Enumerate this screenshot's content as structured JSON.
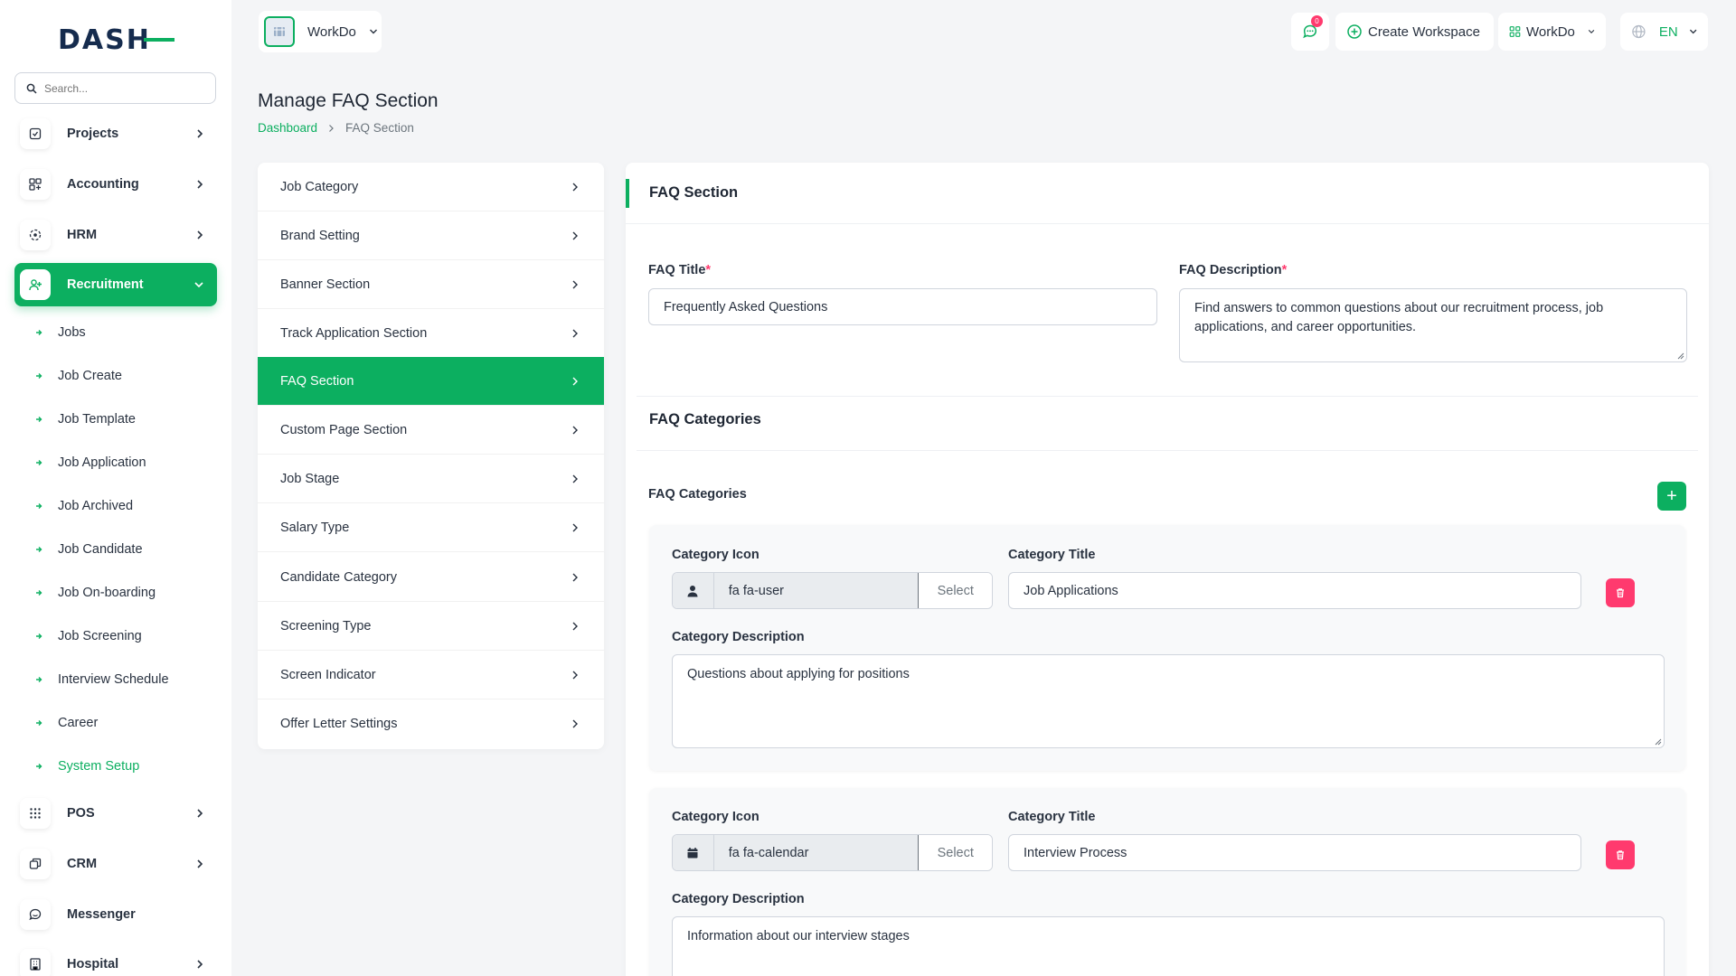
{
  "brand": {
    "logo_text": "DASH",
    "accent": "#0caf60"
  },
  "search": {
    "placeholder": "Search..."
  },
  "sidebar": {
    "items": [
      {
        "label": "Projects",
        "icon": "checkbox-icon"
      },
      {
        "label": "Accounting",
        "icon": "grid-icon"
      },
      {
        "label": "HRM",
        "icon": "hrm-icon"
      },
      {
        "label": "Recruitment",
        "icon": "user-plus-icon"
      },
      {
        "label": "POS",
        "icon": "dots-grid-icon"
      },
      {
        "label": "CRM",
        "icon": "layers-icon"
      },
      {
        "label": "Messenger",
        "icon": "chat-icon"
      },
      {
        "label": "Hospital",
        "icon": "building-icon"
      }
    ],
    "recruitment_sub": [
      "Jobs",
      "Job Create",
      "Job Template",
      "Job Application",
      "Job Archived",
      "Job Candidate",
      "Job On-boarding",
      "Job Screening",
      "Interview Schedule",
      "Career",
      "System Setup"
    ]
  },
  "topbar": {
    "workspace_name": "WorkDo",
    "notification_count": "0",
    "create_workspace": "Create Workspace",
    "workspace_switch": "WorkDo",
    "language": "EN"
  },
  "page": {
    "title": "Manage FAQ Section",
    "breadcrumb_home": "Dashboard",
    "breadcrumb_current": "FAQ Section"
  },
  "settings_menu": [
    "Job Category",
    "Brand Setting",
    "Banner Section",
    "Track Application Section",
    "FAQ Section",
    "Custom Page Section",
    "Job Stage",
    "Salary Type",
    "Candidate Category",
    "Screening Type",
    "Screen Indicator",
    "Offer Letter Settings"
  ],
  "faq": {
    "card_title": "FAQ Section",
    "title_label": "FAQ Title",
    "title_value": "Frequently Asked Questions",
    "desc_label": "FAQ Description",
    "desc_value": "Find answers to common questions about our recruitment process, job applications, and career opportunities.",
    "categories_heading": "FAQ Categories",
    "categories_subheading": "FAQ Categories",
    "add_symbol": "+",
    "field_labels": {
      "icon": "Category Icon",
      "title": "Category Title",
      "description": "Category Description",
      "select": "Select"
    },
    "categories": [
      {
        "icon_class": "fa fa-user",
        "title": "Job Applications",
        "description": "Questions about applying for positions"
      },
      {
        "icon_class": "fa fa-calendar",
        "title": "Interview Process",
        "description": "Information about our interview stages"
      }
    ]
  }
}
